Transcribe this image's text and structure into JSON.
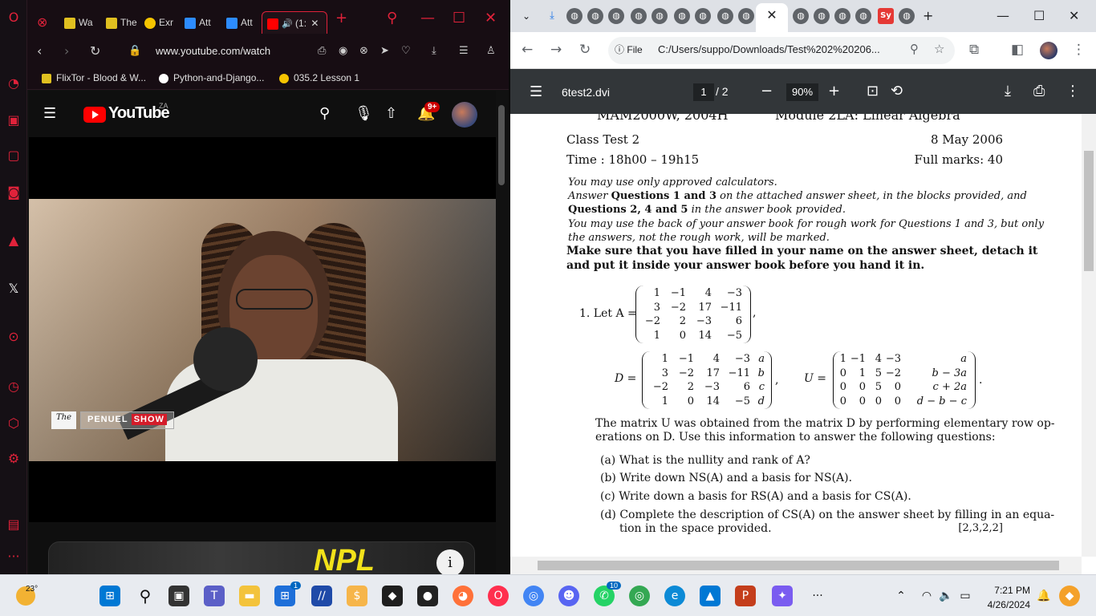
{
  "opera": {
    "tabs": [
      {
        "label": "Wa",
        "color": "#e0c020"
      },
      {
        "label": "The",
        "color": "#e0c020"
      },
      {
        "label": "Exr",
        "color": "#f5c400",
        "icon_text": "ex"
      },
      {
        "label": "Att",
        "color": "#2d8cff"
      },
      {
        "label": "Att",
        "color": "#2d8cff"
      },
      {
        "label": "(1:",
        "color": "#ff0000"
      }
    ],
    "url": "www.youtube.com/watch",
    "bookmarks": [
      {
        "label": "FlixTor - Blood & W...",
        "color": "#e0c020"
      },
      {
        "label": "Python-and-Django...",
        "color": "#ffffff"
      },
      {
        "label": "035.2 Lesson 1",
        "color": "#f5c400"
      }
    ]
  },
  "youtube": {
    "logo_text": "YouTube",
    "region": "ZA",
    "notification_count": "9+",
    "overlay_tag": "The",
    "overlay_show": "PENUEL",
    "overlay_show_2": "SHOW",
    "card_text": "NPL",
    "info_glyph": "i"
  },
  "chrome": {
    "omnibox_chip": "File",
    "omnibox_url": "C:/Users/suppo/Downloads/Test%202%20206...",
    "sy_tab": "Sy"
  },
  "pdf": {
    "title": "6test2.dvi",
    "page_current": "1",
    "page_total": "2",
    "zoom": "90%",
    "header_cut": "MAM2000W, 2004H",
    "header_cut_right": "Module 2LA: Linear Algebra",
    "class_test": "Class Test 2",
    "date": "8 May 2006",
    "time": "Time : 18h00 – 19h15",
    "full_marks": "Full marks: 40",
    "instr_1": "You may use only approved calculators.",
    "instr_2a": "Answer",
    "instr_2b": "Questions 1 and 3",
    "instr_2c": "on the attached answer sheet, in the blocks provided, and",
    "instr_3a": "Questions 2, 4 and 5",
    "instr_3b": "in the answer book provided.",
    "instr_4": "You may use the back of your answer book for rough work for Questions 1 and 3, but only",
    "instr_5": "the answers, not the rough work, will be marked.",
    "instr_6": "Make sure that you have filled in your name on the answer sheet, detach it",
    "instr_7": "and put it inside your answer book before you hand it in.",
    "q1_label": "1.  Let A =",
    "matrix_A": [
      [
        "1",
        "−1",
        "4",
        "−3"
      ],
      [
        "3",
        "−2",
        "17",
        "−11"
      ],
      [
        "−2",
        "2",
        "−3",
        "6"
      ],
      [
        "1",
        "0",
        "14",
        "−5"
      ]
    ],
    "matrix_D_label": "D =",
    "matrix_D": [
      [
        "1",
        "−1",
        "4",
        "−3",
        "a"
      ],
      [
        "3",
        "−2",
        "17",
        "−11",
        "b"
      ],
      [
        "−2",
        "2",
        "−3",
        "6",
        "c"
      ],
      [
        "1",
        "0",
        "14",
        "−5",
        "d"
      ]
    ],
    "matrix_U_label": "U =",
    "matrix_U": [
      [
        "1",
        "−1",
        "4",
        "−3",
        "a"
      ],
      [
        "0",
        "1",
        "5",
        "−2",
        "b − 3a"
      ],
      [
        "0",
        "0",
        "5",
        "0",
        "c + 2a"
      ],
      [
        "0",
        "0",
        "0",
        "0",
        "d − b − c"
      ]
    ],
    "para_1": "The matrix U was obtained from the matrix D by performing elementary row op-",
    "para_2": "erations on D. Use this information to answer the following questions:",
    "q_a": "(a)  What is the nullity and rank of A?",
    "q_b": "(b)  Write down NS(A) and a basis for NS(A).",
    "q_c": "(c)  Write down a basis for RS(A) and a basis for CS(A).",
    "q_d1": "(d)  Complete the description of CS(A) on the answer sheet by filling in an equa-",
    "q_d2": "tion in the space provided.",
    "marks": "[2,3,2,2]"
  },
  "taskbar": {
    "temperature": "23°",
    "time": "7:21 PM",
    "date": "4/26/2024",
    "badge_store": "1",
    "badge_discord": "10"
  }
}
